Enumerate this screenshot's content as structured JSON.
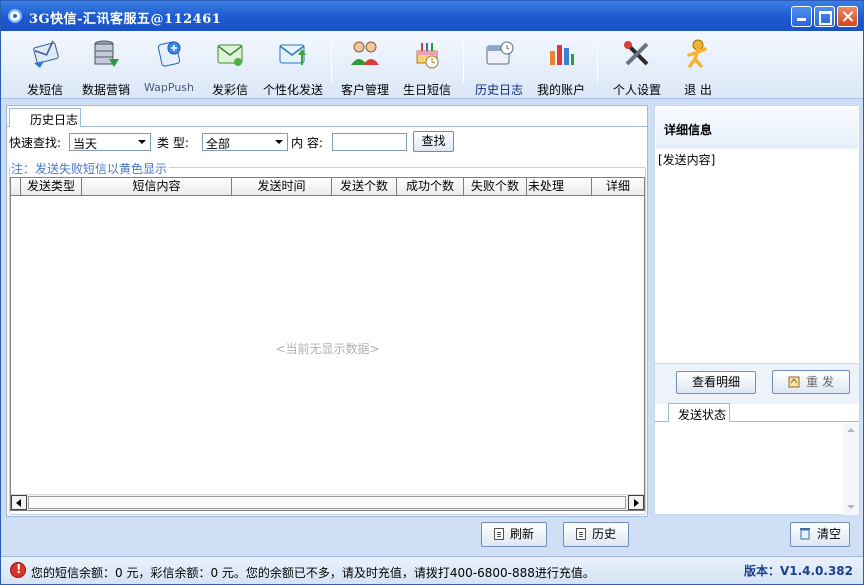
{
  "window": {
    "title": "3G快信-汇讯客服五@112461"
  },
  "toolbar": {
    "items": [
      {
        "label": "发短信",
        "icon": "envelope-arrow-icon"
      },
      {
        "label": "数据营销",
        "icon": "database-icon"
      },
      {
        "label": "WapPush",
        "icon": "wap-push-icon"
      },
      {
        "label": "发彩信",
        "icon": "mms-envelope-icon"
      },
      {
        "label": "个性化发送",
        "icon": "personal-mail-icon"
      },
      {
        "label": "客户管理",
        "icon": "customers-icon"
      },
      {
        "label": "生日短信",
        "icon": "birthday-cake-icon"
      },
      {
        "label": "历史日志",
        "icon": "calendar-clock-icon"
      },
      {
        "label": "我的账户",
        "icon": "bar-chart-icon"
      },
      {
        "label": "个人设置",
        "icon": "tools-icon"
      },
      {
        "label": "退 出",
        "icon": "exit-figure-icon"
      }
    ]
  },
  "history_tab": {
    "label": "历史日志"
  },
  "search": {
    "quick_label": "快速查找:",
    "quick_value": "当天",
    "type_label": "类 型:",
    "type_value": "全部",
    "content_label": "内 容:",
    "content_value": "",
    "search_button": "查找"
  },
  "note": "注：发送失败短信以黄色显示",
  "table": {
    "columns": [
      "发送类型",
      "短信内容",
      "发送时间",
      "发送个数",
      "成功个数",
      "失败个数",
      "未处理",
      "详细"
    ],
    "rows": [],
    "empty_text": "<当前无显示数据>"
  },
  "bottom_buttons": {
    "refresh": "刷新",
    "history": "历史"
  },
  "detail": {
    "title": "详细信息",
    "content": "[发送内容]",
    "view_detail_button": "查看明细",
    "resend_button": "重 发",
    "status_tab": "发送状态",
    "clear_button": "清空"
  },
  "statusbar": {
    "message": "您的短信余额：0 元，彩信余额：0 元。您的余额已不多，请及时充值，请拨打400-6800-888进行充值。",
    "version": "版本：V1.4.0.382"
  },
  "colors": {
    "title_bar": "#1d5ad0",
    "window_bg": "#cfe0f6",
    "note_text": "#4a78c8",
    "version_text": "#1b3f8f"
  }
}
